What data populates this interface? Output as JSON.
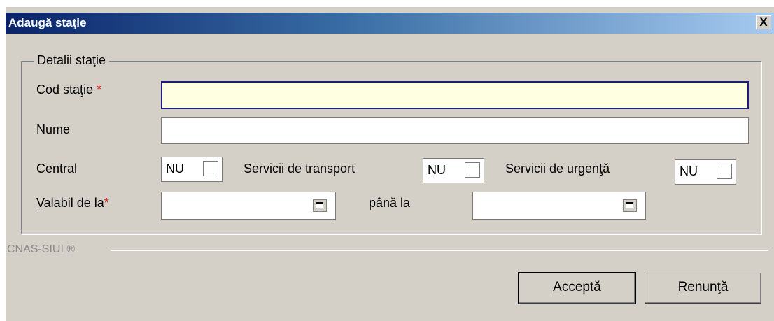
{
  "dialog": {
    "title": "Adaugă staţie",
    "close_label": "X"
  },
  "group": {
    "legend": "Detalii staţie"
  },
  "fields": {
    "cod_label": "Cod staţie",
    "required_mark": "*",
    "cod_value": "",
    "nume_label": "Nume",
    "nume_value": "",
    "central_label": "Central",
    "central_value": "NU",
    "transport_label": "Servicii de transport",
    "transport_value": "NU",
    "urgenta_label": "Servicii de urgenţă",
    "urgenta_value": "NU",
    "valabil_label_first": "V",
    "valabil_label_rest": "alabil de la",
    "valabil_value": "",
    "pana_label": "până la",
    "pana_value": ""
  },
  "footer": {
    "brand": "CNAS-SIUI ®"
  },
  "buttons": {
    "accept_first": "A",
    "accept_rest": "cceptă",
    "cancel_first": "R",
    "cancel_rest": "enunţă"
  },
  "icons": [
    "close-icon",
    "calendar-icon"
  ],
  "colors": {
    "title_gradient_start": "#0a246a",
    "title_gradient_end": "#a6caf0",
    "dialog_bg": "#d4d0c8",
    "active_field_bg": "#ffffe1",
    "required": "#e02020"
  }
}
